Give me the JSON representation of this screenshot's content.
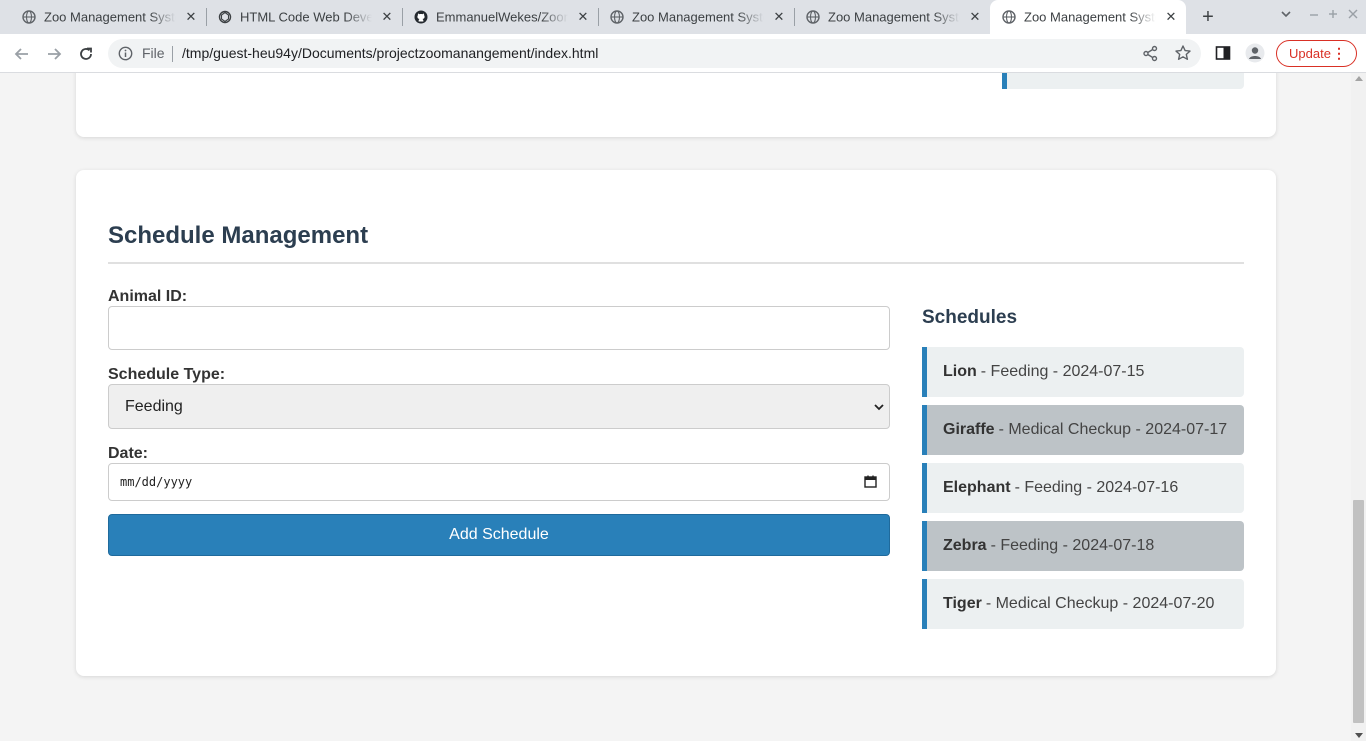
{
  "browser": {
    "tabs": [
      {
        "title": "Zoo Management Syste",
        "icon": "globe-icon",
        "active": false
      },
      {
        "title": "HTML Code Web Develo",
        "icon": "openai-icon",
        "active": false
      },
      {
        "title": "EmmanuelWekes/Zoom",
        "icon": "github-icon",
        "active": false
      },
      {
        "title": "Zoo Management Syste",
        "icon": "globe-icon",
        "active": false
      },
      {
        "title": "Zoo Management Syste",
        "icon": "globe-icon",
        "active": false
      },
      {
        "title": "Zoo Management Syste",
        "icon": "globe-icon",
        "active": true
      }
    ],
    "tab_close": "✕",
    "new_tab": "+",
    "address": {
      "scheme_label": "File",
      "url": "/tmp/guest-heu94y/Documents/projectzoomanangement/index.html"
    },
    "update_label": "Update"
  },
  "page": {
    "schedule_section": {
      "title": "Schedule Management",
      "form": {
        "animal_id_label": "Animal ID:",
        "animal_id_value": "",
        "schedule_type_label": "Schedule Type:",
        "schedule_type_value": "Feeding",
        "date_label": "Date:",
        "date_placeholder": "mm/dd/yyyy",
        "submit_label": "Add Schedule"
      },
      "list_title": "Schedules",
      "schedules": [
        {
          "animal": "Lion",
          "detail": "- Feeding - 2024-07-15",
          "highlighted": false
        },
        {
          "animal": "Giraffe",
          "detail": "- Medical Checkup - 2024-07-17",
          "highlighted": true
        },
        {
          "animal": "Elephant",
          "detail": "- Feeding - 2024-07-16",
          "highlighted": false
        },
        {
          "animal": "Zebra",
          "detail": "- Feeding - 2024-07-18",
          "highlighted": true
        },
        {
          "animal": "Tiger",
          "detail": "- Medical Checkup - 2024-07-20",
          "highlighted": false
        }
      ]
    }
  },
  "colors": {
    "accent": "#2980b9",
    "heading": "#2c3e50",
    "item_bg": "#ecf0f1",
    "item_highlight_bg": "#bdc3c7",
    "update_red": "#d93025"
  }
}
